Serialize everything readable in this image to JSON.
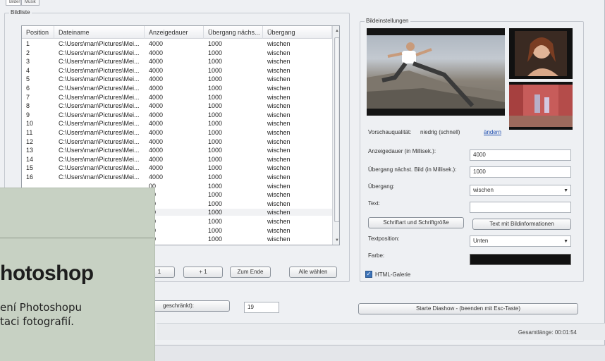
{
  "tabs": [
    "Bilder",
    "Musik"
  ],
  "list_group_label": "Bildliste",
  "settings_group_label": "Bildeinstellungen",
  "columns": [
    "Position",
    "Dateiname",
    "Anzeigedauer",
    "Übergang nächs...",
    "Übergang"
  ],
  "rows": [
    [
      "1",
      "C:\\Users\\man\\Pictures\\Mei...",
      "4000",
      "1000",
      "wischen"
    ],
    [
      "2",
      "C:\\Users\\man\\Pictures\\Mei...",
      "4000",
      "1000",
      "wischen"
    ],
    [
      "3",
      "C:\\Users\\man\\Pictures\\Mei...",
      "4000",
      "1000",
      "wischen"
    ],
    [
      "4",
      "C:\\Users\\man\\Pictures\\Mei...",
      "4000",
      "1000",
      "wischen"
    ],
    [
      "5",
      "C:\\Users\\man\\Pictures\\Mei...",
      "4000",
      "1000",
      "wischen"
    ],
    [
      "6",
      "C:\\Users\\man\\Pictures\\Mei...",
      "4000",
      "1000",
      "wischen"
    ],
    [
      "7",
      "C:\\Users\\man\\Pictures\\Mei...",
      "4000",
      "1000",
      "wischen"
    ],
    [
      "8",
      "C:\\Users\\man\\Pictures\\Mei...",
      "4000",
      "1000",
      "wischen"
    ],
    [
      "9",
      "C:\\Users\\man\\Pictures\\Mei...",
      "4000",
      "1000",
      "wischen"
    ],
    [
      "10",
      "C:\\Users\\man\\Pictures\\Mei...",
      "4000",
      "1000",
      "wischen"
    ],
    [
      "11",
      "C:\\Users\\man\\Pictures\\Mei...",
      "4000",
      "1000",
      "wischen"
    ],
    [
      "12",
      "C:\\Users\\man\\Pictures\\Mei...",
      "4000",
      "1000",
      "wischen"
    ],
    [
      "13",
      "C:\\Users\\man\\Pictures\\Mei...",
      "4000",
      "1000",
      "wischen"
    ],
    [
      "14",
      "C:\\Users\\man\\Pictures\\Mei...",
      "4000",
      "1000",
      "wischen"
    ],
    [
      "15",
      "C:\\Users\\man\\Pictures\\Mei...",
      "4000",
      "1000",
      "wischen"
    ],
    [
      "16",
      "C:\\Users\\man\\Pictures\\Mei...",
      "4000",
      "1000",
      "wischen"
    ],
    [
      "",
      "",
      "00",
      "1000",
      "wischen"
    ],
    [
      "",
      "",
      "00",
      "1000",
      "wischen"
    ],
    [
      "",
      "",
      "00",
      "1000",
      "wischen"
    ],
    [
      "",
      "",
      "00",
      "1000",
      "wischen"
    ],
    [
      "",
      "",
      "00",
      "1000",
      "wischen"
    ],
    [
      "",
      "",
      "00",
      "1000",
      "wischen"
    ],
    [
      "",
      "",
      "00",
      "1000",
      "wischen"
    ]
  ],
  "list_buttons": {
    "one": "1",
    "plus_one": "+ 1",
    "to_end": "Zum Ende",
    "select_all": "Alle wählen"
  },
  "preview_quality": {
    "label": "Vorschauqualität:",
    "value": "niedrig (schnell)",
    "change_link": "ändern"
  },
  "settings": {
    "display_duration_label": "Anzeigedauer (in Millisek.):",
    "display_duration_value": "4000",
    "transition_next_label": "Übergang nächst. Bild (in Millisek.):",
    "transition_next_value": "1000",
    "transition_label": "Übergang:",
    "transition_value": "wischen",
    "text_label": "Text:",
    "text_value": "",
    "font_button": "Schriftart und Schriftgröße",
    "image_info_button": "Text mit Bildinformationen",
    "text_position_label": "Textposition:",
    "text_position_value": "Unten",
    "color_label": "Farbe:",
    "color_value": "#111111",
    "html_gallery_label": "HTML-Galerie"
  },
  "bottom": {
    "limit_button": "geschränkt):",
    "limit_value": "19",
    "start_button": "Starte Diashow  -  (beenden mit Esc-Taste)",
    "total_length": "Gesamtlänge: 00:01:54"
  },
  "overlay": {
    "heading": "hotoshop",
    "line1": "ení Photoshopu",
    "line2": "taci fotografií."
  }
}
